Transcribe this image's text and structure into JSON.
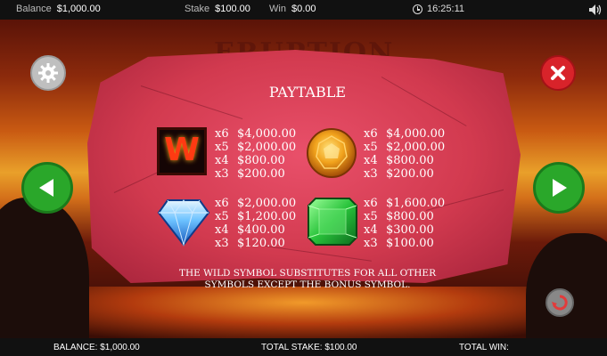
{
  "topbar": {
    "balance_label": "Balance",
    "balance_value": "$1,000.00",
    "stake_label": "Stake",
    "stake_value": "$100.00",
    "win_label": "Win",
    "win_value": "$0.00",
    "time": "16:25:11",
    "icons": [
      "clock-icon",
      "speaker-icon"
    ]
  },
  "game": {
    "title": "ERUPTION"
  },
  "paytable": {
    "title": "PAYTABLE",
    "symbols": [
      {
        "name": "wild",
        "icon": "wild-w-icon",
        "glyph": "W",
        "pays": [
          {
            "mult": "x6",
            "amount": "$4,000.00"
          },
          {
            "mult": "x5",
            "amount": "$2,000.00"
          },
          {
            "mult": "x4",
            "amount": "$800.00"
          },
          {
            "mult": "x3",
            "amount": "$200.00"
          }
        ]
      },
      {
        "name": "orange-gem",
        "icon": "orange-gem-icon",
        "pays": [
          {
            "mult": "x6",
            "amount": "$4,000.00"
          },
          {
            "mult": "x5",
            "amount": "$2,000.00"
          },
          {
            "mult": "x4",
            "amount": "$800.00"
          },
          {
            "mult": "x3",
            "amount": "$200.00"
          }
        ]
      },
      {
        "name": "blue-diamond",
        "icon": "blue-diamond-icon",
        "pays": [
          {
            "mult": "x6",
            "amount": "$2,000.00"
          },
          {
            "mult": "x5",
            "amount": "$1,200.00"
          },
          {
            "mult": "x4",
            "amount": "$400.00"
          },
          {
            "mult": "x3",
            "amount": "$120.00"
          }
        ]
      },
      {
        "name": "green-emerald",
        "icon": "green-emerald-icon",
        "pays": [
          {
            "mult": "x6",
            "amount": "$1,600.00"
          },
          {
            "mult": "x5",
            "amount": "$800.00"
          },
          {
            "mult": "x4",
            "amount": "$300.00"
          },
          {
            "mult": "x3",
            "amount": "$100.00"
          }
        ]
      }
    ],
    "rule_line1": "THE WILD SYMBOL SUBSTITUTES FOR ALL OTHER",
    "rule_line2": "SYMBOLS EXCEPT THE BONUS SYMBOL."
  },
  "buttons": {
    "settings": "gear-icon",
    "close": "close-icon",
    "prev": "arrow-left-icon",
    "next": "arrow-right-icon",
    "spin": "spin-icon"
  },
  "bottombar": {
    "balance_label": "BALANCE:",
    "balance_value": "$1,000.00",
    "stake_label": "TOTAL STAKE:",
    "stake_value": "$100.00",
    "win_label": "TOTAL WIN:",
    "win_value": ""
  },
  "colors": {
    "panel_red": "#d23a4f",
    "button_green": "#2aa72a",
    "close_red": "#d8232a",
    "wild_orange": "#ff3a12"
  }
}
